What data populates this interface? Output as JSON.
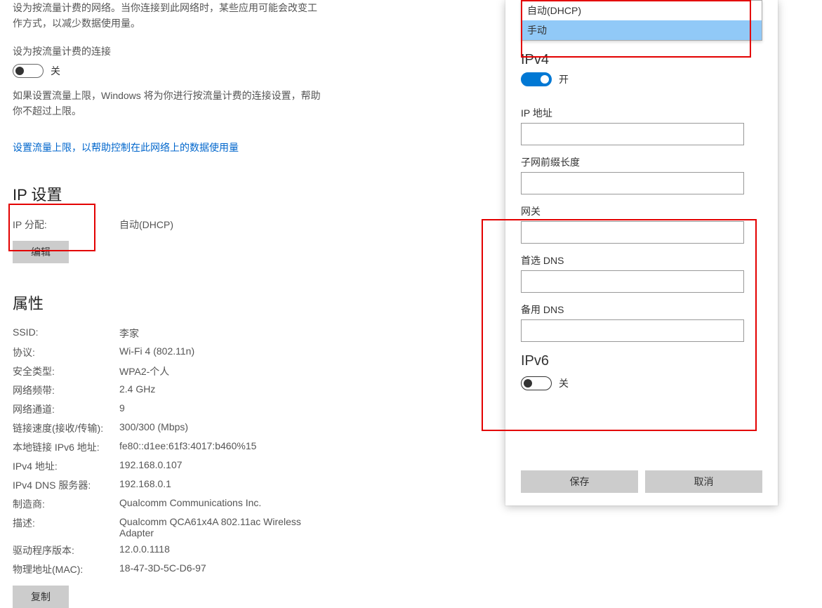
{
  "left": {
    "desc1": "设为按流量计费的网络。当你连接到此网络时，某些应用可能会改变工作方式，以减少数据使用量。",
    "meter_heading": "设为按流量计费的连接",
    "meter_toggle_state": "关",
    "desc2": "如果设置流量上限，Windows 将为你进行按流量计费的连接设置，帮助你不超过上限。",
    "link_text": "设置流量上限，以帮助控制在此网络上的数据使用量",
    "ip_settings_heading": "IP 设置",
    "ip_assign_label": "IP 分配:",
    "ip_assign_value": "自动(DHCP)",
    "edit_button": "编辑",
    "props_heading": "属性",
    "props": [
      {
        "k": "SSID:",
        "v": "李家"
      },
      {
        "k": "协议:",
        "v": "Wi-Fi 4 (802.11n)"
      },
      {
        "k": "安全类型:",
        "v": "WPA2-个人"
      },
      {
        "k": "网络频带:",
        "v": "2.4 GHz"
      },
      {
        "k": "网络通道:",
        "v": "9"
      },
      {
        "k": "链接速度(接收/传输):",
        "v": "300/300 (Mbps)"
      },
      {
        "k": "本地链接 IPv6 地址:",
        "v": "fe80::d1ee:61f3:4017:b460%15"
      },
      {
        "k": "IPv4 地址:",
        "v": "192.168.0.107"
      },
      {
        "k": "IPv4 DNS 服务器:",
        "v": "192.168.0.1"
      },
      {
        "k": "制造商:",
        "v": "Qualcomm Communications Inc."
      },
      {
        "k": "描述:",
        "v": "Qualcomm QCA61x4A 802.11ac Wireless Adapter"
      },
      {
        "k": "驱动程序版本:",
        "v": "12.0.0.1118"
      },
      {
        "k": "物理地址(MAC):",
        "v": "18-47-3D-5C-D6-97"
      }
    ],
    "copy_button": "复制"
  },
  "dialog": {
    "dropdown_options": [
      "自动(DHCP)",
      "手动"
    ],
    "dropdown_selected": "手动",
    "ipv4_heading": "IPv4",
    "ipv4_toggle_state": "开",
    "fields": {
      "ip_address": "IP 地址",
      "subnet_prefix": "子网前缀长度",
      "gateway": "网关",
      "preferred_dns": "首选 DNS",
      "alternate_dns": "备用 DNS"
    },
    "ipv6_heading": "IPv6",
    "ipv6_toggle_state": "关",
    "save_button": "保存",
    "cancel_button": "取消"
  }
}
